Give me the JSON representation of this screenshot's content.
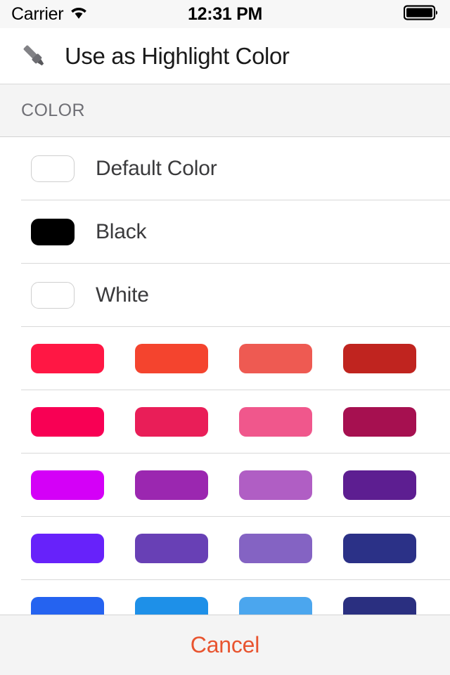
{
  "status_bar": {
    "carrier": "Carrier",
    "wifi_icon": "wifi-icon",
    "time": "12:31 PM",
    "battery_icon": "battery-full-icon"
  },
  "nav": {
    "icon": "highlighter-marker-icon",
    "title": "Use as Highlight Color"
  },
  "section": {
    "header": "COLOR"
  },
  "named_colors": [
    {
      "label": "Default Color",
      "value": "#ffffff",
      "border": "#cfcfcf"
    },
    {
      "label": "Black",
      "value": "#000000",
      "border": "#000000"
    },
    {
      "label": "White",
      "value": "#ffffff",
      "border": "#cfcfcf"
    }
  ],
  "color_grid": {
    "columns": 4,
    "rows": [
      {
        "name": "reds",
        "swatches": [
          "#FF1744",
          "#F4442E",
          "#EE5A52",
          "#C0241F"
        ]
      },
      {
        "name": "pinks",
        "swatches": [
          "#F80054",
          "#E91E58",
          "#F0578C",
          "#A61050"
        ]
      },
      {
        "name": "magentas",
        "swatches": [
          "#D400F7",
          "#9B27B0",
          "#B05EC4",
          "#5D1E91"
        ]
      },
      {
        "name": "violets",
        "swatches": [
          "#6722FA",
          "#6840B5",
          "#8463C3",
          "#2B3187"
        ]
      },
      {
        "name": "blues",
        "swatches": [
          "#2563F0",
          "#1E90E8",
          "#4BA6EE",
          "#2A2F80"
        ]
      }
    ]
  },
  "footer": {
    "cancel_label": "Cancel",
    "cancel_color": "#E8542F"
  }
}
